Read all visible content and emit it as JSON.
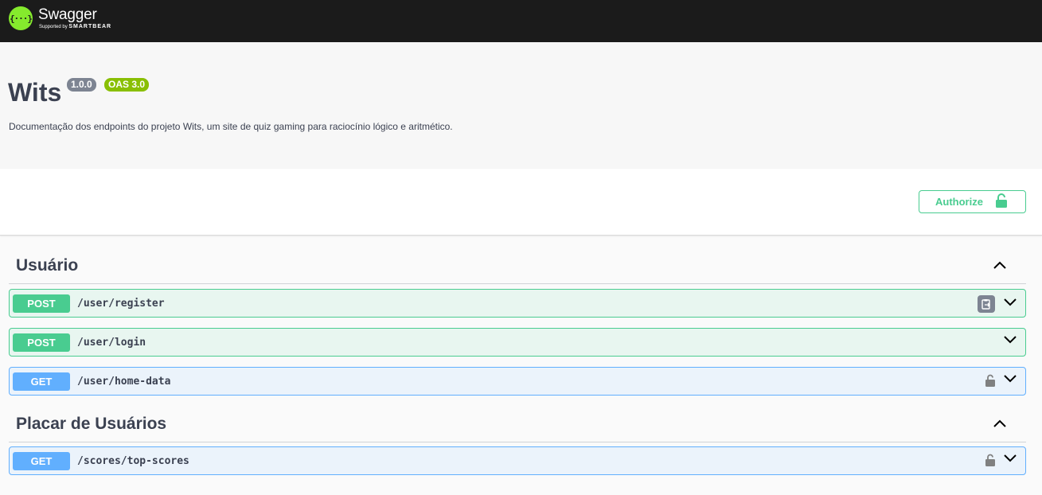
{
  "topbar": {
    "logo_mark": "{···}",
    "logo_title": "Swagger",
    "logo_supported": "Supported by",
    "logo_brand": "SMARTBEAR"
  },
  "info": {
    "title": "Wits",
    "version": "1.0.0",
    "oas": "OAS 3.0",
    "description": "Documentação dos endpoints do projeto Wits, um site de quiz gaming para raciocínio lógico e aritmético."
  },
  "authorize": {
    "label": "Authorize"
  },
  "tags": [
    {
      "name": "Usuário",
      "operations": [
        {
          "method": "POST",
          "path": "/user/register"
        },
        {
          "method": "POST",
          "path": "/user/login"
        },
        {
          "method": "GET",
          "path": "/user/home-data"
        }
      ]
    },
    {
      "name": "Placar de Usuários",
      "operations": [
        {
          "method": "GET",
          "path": "/scores/top-scores"
        }
      ]
    }
  ],
  "colors": {
    "post": "#49cc90",
    "get": "#61affe",
    "topbar": "#1b1b1b",
    "logo": "#85ea2d"
  }
}
